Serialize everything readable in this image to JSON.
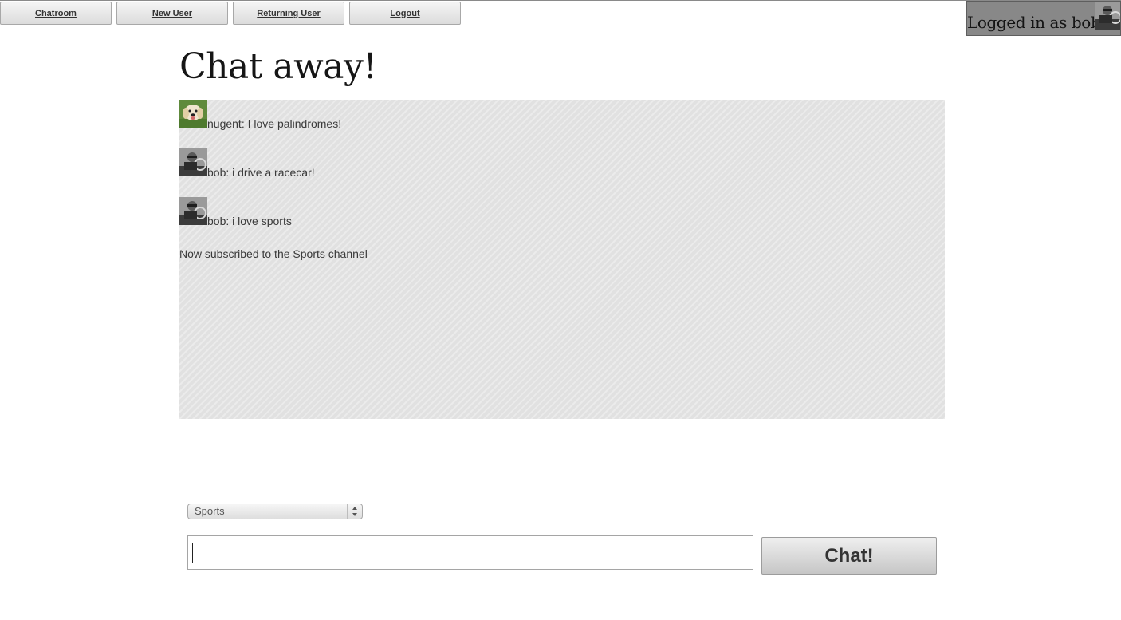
{
  "nav": {
    "items": [
      {
        "label": "Chatroom"
      },
      {
        "label": "New User"
      },
      {
        "label": "Returning User"
      },
      {
        "label": "Logout"
      }
    ]
  },
  "login": {
    "text": "Logged in as bob"
  },
  "page": {
    "title": "Chat away!"
  },
  "messages": [
    {
      "avatar": "dog-avatar",
      "text": "nugent: I love palindromes!"
    },
    {
      "avatar": "bob-avatar",
      "text": "bob: i drive a racecar!"
    },
    {
      "avatar": "bob-avatar",
      "text": "bob: i love sports"
    }
  ],
  "status": {
    "text": "Now subscribed to the Sports channel"
  },
  "channel": {
    "selected": "Sports"
  },
  "composer": {
    "value": "",
    "button_label": "Chat!"
  },
  "colors": {
    "chat_bg": "#e1e1e1",
    "login_bg": "#888888"
  }
}
